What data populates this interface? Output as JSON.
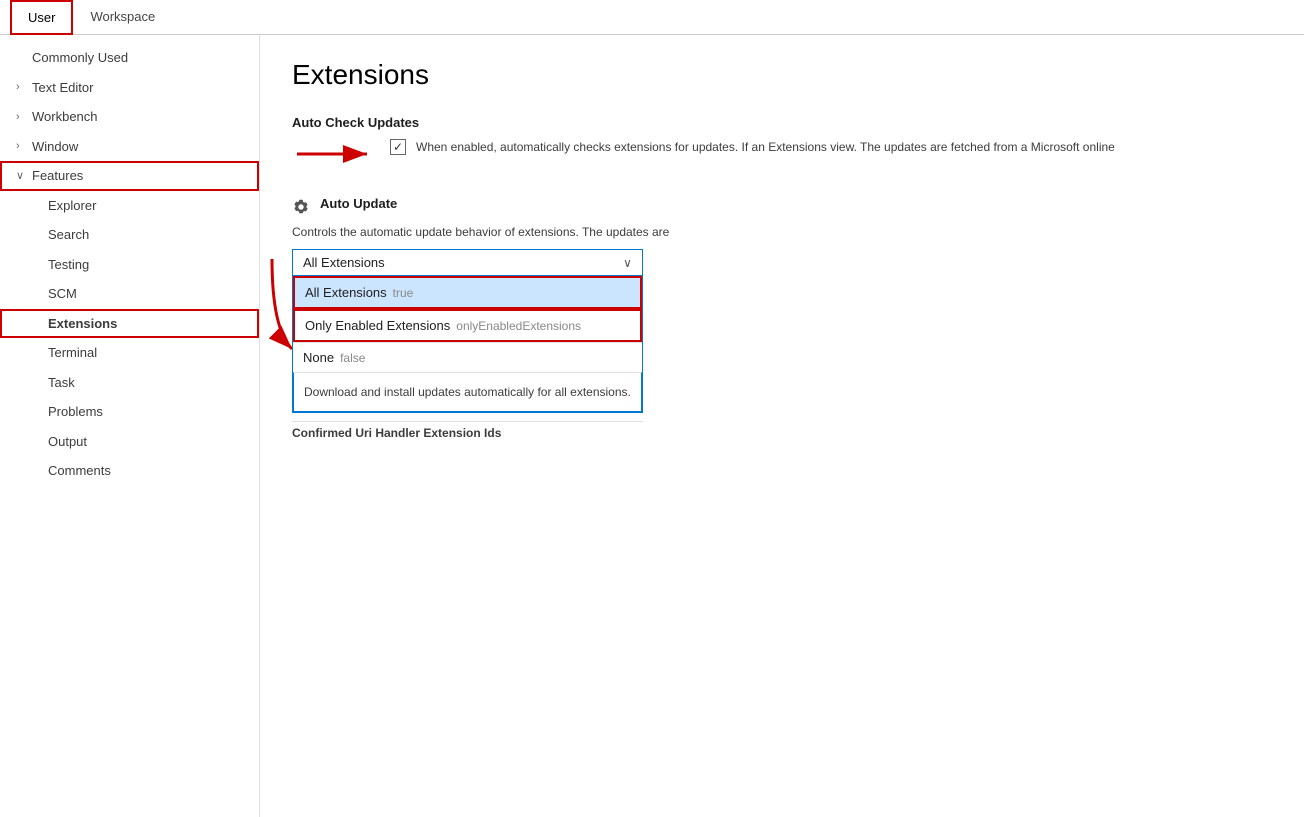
{
  "tabs": [
    {
      "label": "User",
      "active": true
    },
    {
      "label": "Workspace",
      "active": false
    }
  ],
  "sidebar": {
    "items": [
      {
        "id": "commonly-used",
        "label": "Commonly Used",
        "indent": "root",
        "chevron": ""
      },
      {
        "id": "text-editor",
        "label": "Text Editor",
        "indent": "root",
        "chevron": "›"
      },
      {
        "id": "workbench",
        "label": "Workbench",
        "indent": "root",
        "chevron": "›"
      },
      {
        "id": "window",
        "label": "Window",
        "indent": "root",
        "chevron": "›"
      },
      {
        "id": "features",
        "label": "Features",
        "indent": "root",
        "chevron": "∨",
        "boxed": true
      },
      {
        "id": "explorer",
        "label": "Explorer",
        "indent": "sub",
        "chevron": ""
      },
      {
        "id": "search",
        "label": "Search",
        "indent": "sub",
        "chevron": ""
      },
      {
        "id": "testing",
        "label": "Testing",
        "indent": "sub",
        "chevron": ""
      },
      {
        "id": "scm",
        "label": "SCM",
        "indent": "sub",
        "chevron": ""
      },
      {
        "id": "extensions",
        "label": "Extensions",
        "indent": "sub",
        "chevron": "",
        "selected": true
      },
      {
        "id": "terminal",
        "label": "Terminal",
        "indent": "sub",
        "chevron": ""
      },
      {
        "id": "task",
        "label": "Task",
        "indent": "sub",
        "chevron": ""
      },
      {
        "id": "problems",
        "label": "Problems",
        "indent": "sub",
        "chevron": ""
      },
      {
        "id": "output",
        "label": "Output",
        "indent": "sub",
        "chevron": ""
      },
      {
        "id": "comments",
        "label": "Comments",
        "indent": "sub",
        "chevron": ""
      }
    ]
  },
  "content": {
    "page_title": "Extensions",
    "auto_check_updates": {
      "title": "Auto Check Updates",
      "description": "When enabled, automatically checks extensions for updates. If an Extensions view. The updates are fetched from a Microsoft online",
      "checkbox_checked": true
    },
    "auto_update": {
      "title": "Auto Update",
      "description": "Controls the automatic update behavior of extensions. The updates are",
      "selected_value": "All Extensions",
      "options": [
        {
          "label": "All Extensions",
          "value": "true",
          "highlighted": true
        },
        {
          "label": "Only Enabled Extensions",
          "value": "onlyEnabledExtensions",
          "highlighted": false
        },
        {
          "label": "None",
          "value": "false",
          "highlighted": false
        }
      ],
      "option_desc": "Download and install updates automatically for all extensions.",
      "confirmed_label": "Confirmed Uri Handler Extension Ids"
    },
    "dropdown_chevron": "∨"
  }
}
